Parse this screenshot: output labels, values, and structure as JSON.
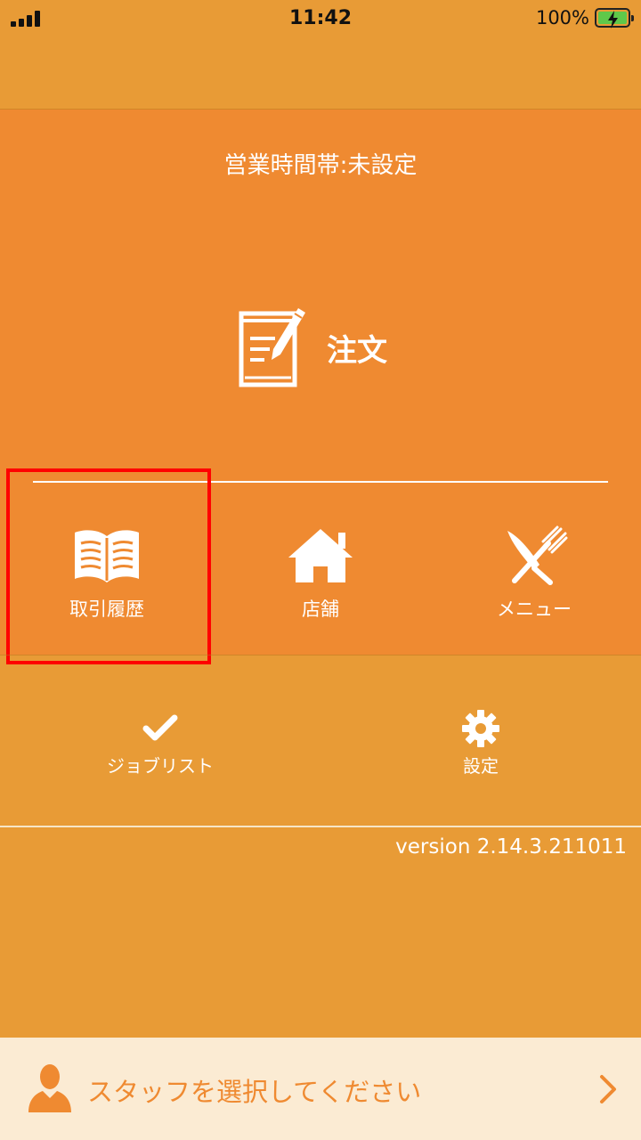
{
  "status_bar": {
    "time": "11:42",
    "battery_percent": "100%"
  },
  "hero": {
    "business_hours": "営業時間帯:未設定",
    "order_label": "注文"
  },
  "tiles": [
    {
      "label": "取引履歴",
      "icon": "book-icon"
    },
    {
      "label": "店舗",
      "icon": "home-icon"
    },
    {
      "label": "メニュー",
      "icon": "fork-knife-icon"
    }
  ],
  "sub_buttons": [
    {
      "label": "ジョブリスト",
      "icon": "check-icon"
    },
    {
      "label": "設定",
      "icon": "gear-icon"
    }
  ],
  "version": "version 2.14.3.211011",
  "staff": {
    "label": "スタッフを選択してください",
    "icon": "person-icon"
  },
  "colors": {
    "background": "#e89b36",
    "hero": "#ef8a31",
    "staff_bar": "#fbebd3",
    "highlight": "#ff0000"
  }
}
